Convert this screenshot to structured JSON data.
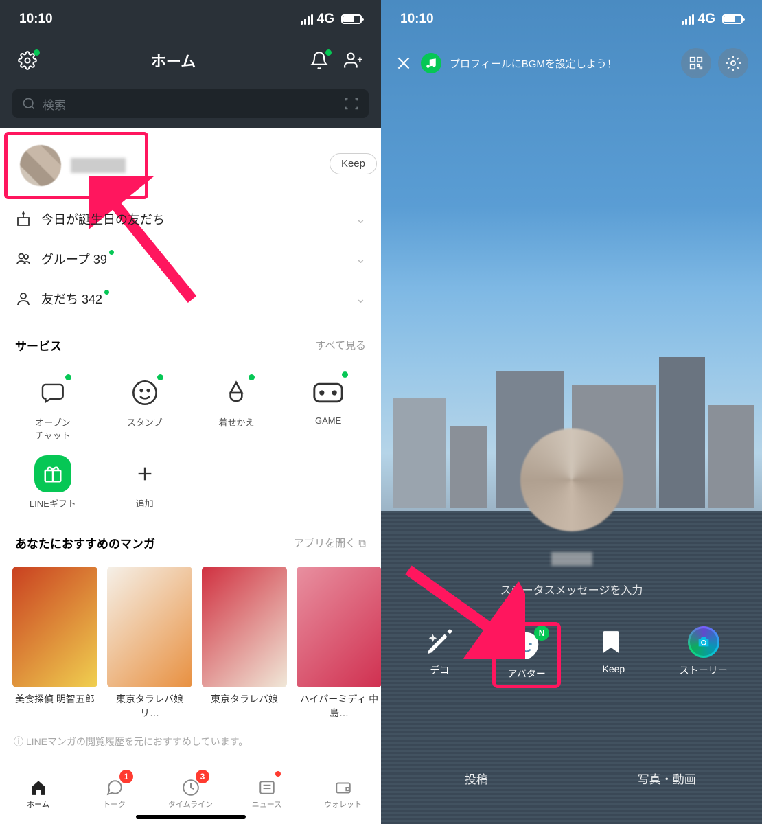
{
  "statusBar": {
    "time": "10:10",
    "network": "4G"
  },
  "left": {
    "headerTitle": "ホーム",
    "searchPlaceholder": "検索",
    "keepLabel": "Keep",
    "rows": {
      "birthday": "今日が誕生日の友だち",
      "groups": "グループ 39",
      "friends": "友だち 342"
    },
    "serviceTitle": "サービス",
    "seeAll": "すべて見る",
    "services": {
      "openchat": "オープン\nチャット",
      "stamp": "スタンプ",
      "kisekae": "着せかえ",
      "game": "GAME",
      "gift": "LINEギフト",
      "add": "追加"
    },
    "mangaTitle": "あなたにおすすめのマンガ",
    "openApp": "アプリを開く",
    "manga": [
      {
        "title": "美食探偵 明智五郎",
        "c1": "#c94020",
        "c2": "#f0d050"
      },
      {
        "title": "東京タラレバ娘 リ…",
        "c1": "#f5f0e8",
        "c2": "#e89040"
      },
      {
        "title": "東京タラレバ娘",
        "c1": "#d03040",
        "c2": "#f0e8d8"
      },
      {
        "title": "ハイパーミディ 中島…",
        "c1": "#e890a0",
        "c2": "#d03050"
      }
    ],
    "note": "LINEマンガの閲覧履歴を元におすすめしています。",
    "tabs": {
      "home": "ホーム",
      "talk": "トーク",
      "talkBadge": "1",
      "timeline": "タイムライン",
      "timelineBadge": "3",
      "news": "ニュース",
      "wallet": "ウォレット"
    }
  },
  "right": {
    "bgmPrompt": "プロフィールにBGMを設定しよう！",
    "statusMsg": "ステータスメッセージを入力",
    "actions": {
      "deco": "デコ",
      "avatar": "アバター",
      "keep": "Keep",
      "story": "ストーリー"
    },
    "nBadge": "N",
    "bottomTabs": {
      "post": "投稿",
      "media": "写真・動画"
    }
  }
}
